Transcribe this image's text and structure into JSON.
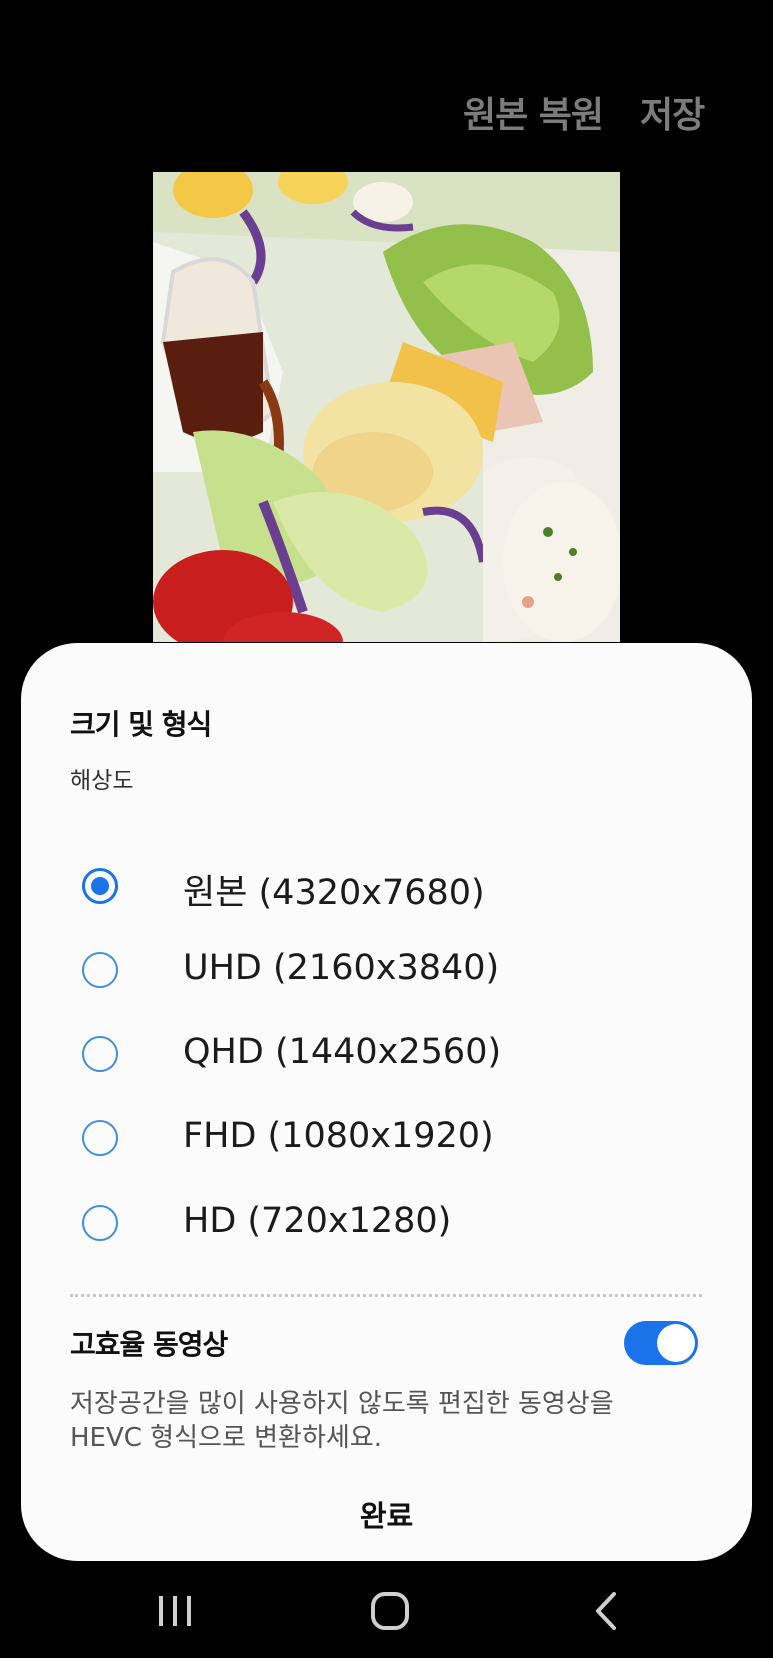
{
  "top_bar": {
    "revert_label": "원본 복원",
    "save_label": "저장"
  },
  "sheet": {
    "title": "크기 및 형식",
    "subtitle": "해상도",
    "options": [
      {
        "label": "원본 (4320x7680)",
        "selected": true
      },
      {
        "label": "UHD (2160x3840)",
        "selected": false
      },
      {
        "label": "QHD (1440x2560)",
        "selected": false
      },
      {
        "label": "FHD (1080x1920)",
        "selected": false
      },
      {
        "label": "HD (720x1280)",
        "selected": false
      }
    ],
    "hevc": {
      "title": "고효율 동영상",
      "enabled": true,
      "description": "저장공간을 많이 사용하지 않도록 편집한 동영상을 HEVC 형식으로 변환하세요."
    },
    "done_label": "완료"
  },
  "colors": {
    "accent": "#1a73e8",
    "sheet_bg": "#fbfbfb",
    "screen_bg": "#000000"
  },
  "icons": {
    "recent": "recent-apps-icon",
    "home": "home-icon",
    "back": "back-icon"
  }
}
